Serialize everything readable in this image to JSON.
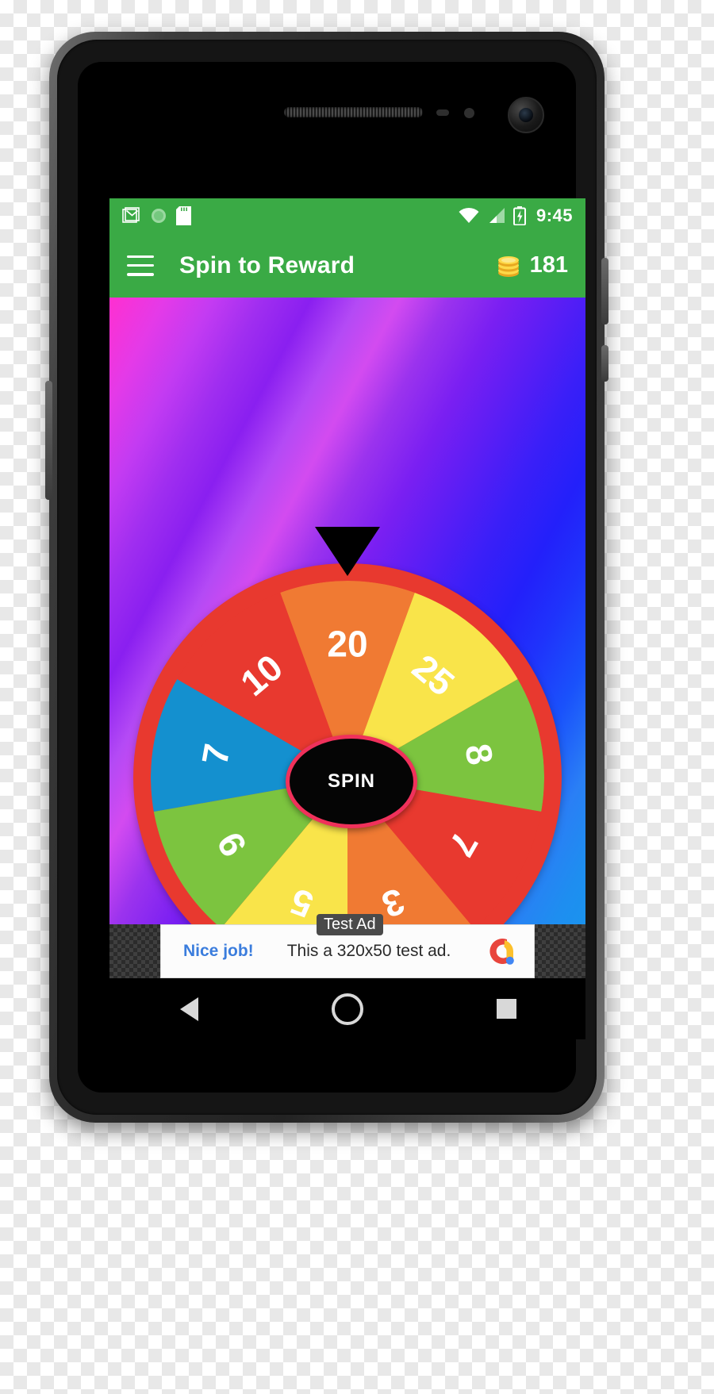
{
  "statusbar": {
    "clock": "9:45",
    "icons": [
      "gmail-icon",
      "sync-icon",
      "sd-card-icon",
      "wifi-icon",
      "signal-icon",
      "battery-charging-icon"
    ]
  },
  "appbar": {
    "menu_icon": "hamburger-menu-icon",
    "title": "Spin to Reward",
    "coin_icon": "coin-stack-icon",
    "coin_count": "181",
    "background_color": "#3aaa45"
  },
  "wheel": {
    "pointer_icon": "triangle-pointer-icon",
    "center_label": "SPIN",
    "rim_color": "#e8392f",
    "hub_border_color": "#f0315b",
    "segments": [
      {
        "label": "20",
        "color": "#f07a33"
      },
      {
        "label": "25",
        "color": "#f9e44a"
      },
      {
        "label": "8",
        "color": "#7cc43f"
      },
      {
        "label": "7",
        "color": "#e8392f"
      },
      {
        "label": "3",
        "color": "#f07a33"
      },
      {
        "label": "5",
        "color": "#f9e44a"
      },
      {
        "label": "9",
        "color": "#7cc43f"
      },
      {
        "label": "7",
        "color": "#1490cf"
      },
      {
        "label": "10",
        "color": "#e8392f"
      }
    ]
  },
  "ad": {
    "badge": "Test Ad",
    "cta": "Nice job!",
    "body": "This a 320x50 test ad.",
    "logo_icon": "admob-logo-icon"
  },
  "navbar": {
    "back": "back-nav-icon",
    "home": "home-nav-icon",
    "recents": "recents-nav-icon"
  }
}
